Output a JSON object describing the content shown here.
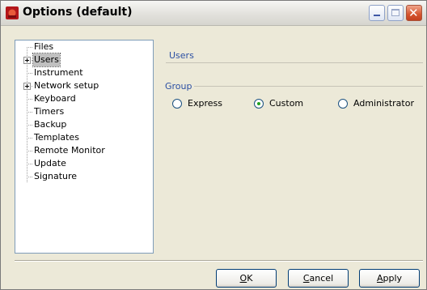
{
  "window": {
    "title": "Options (default)",
    "icon": "app-icon",
    "controls": [
      "minimize-icon",
      "maximize-icon",
      "close-icon"
    ]
  },
  "tree": {
    "items": [
      {
        "label": "Files",
        "expandable": false
      },
      {
        "label": "Users",
        "expandable": true,
        "selected": true
      },
      {
        "label": "Instrument",
        "expandable": false
      },
      {
        "label": "Network setup",
        "expandable": true
      },
      {
        "label": "Keyboard",
        "expandable": false
      },
      {
        "label": "Timers",
        "expandable": false
      },
      {
        "label": "Backup",
        "expandable": false
      },
      {
        "label": "Templates",
        "expandable": false
      },
      {
        "label": "Remote Monitor",
        "expandable": false
      },
      {
        "label": "Update",
        "expandable": false
      },
      {
        "label": "Signature",
        "expandable": false
      }
    ]
  },
  "panel": {
    "title": "Users",
    "group": {
      "label": "Group",
      "options": [
        "Express",
        "Custom",
        "Administrator"
      ],
      "selected": "Custom"
    }
  },
  "buttons": {
    "ok": {
      "accel": "O",
      "rest": "K"
    },
    "cancel": {
      "accel": "C",
      "rest": "ancel"
    },
    "apply": {
      "accel": "A",
      "rest": "pply"
    }
  },
  "colors": {
    "accent": "#2b4fa3",
    "radio_selected": "#21a121",
    "face": "#ece9d8"
  }
}
